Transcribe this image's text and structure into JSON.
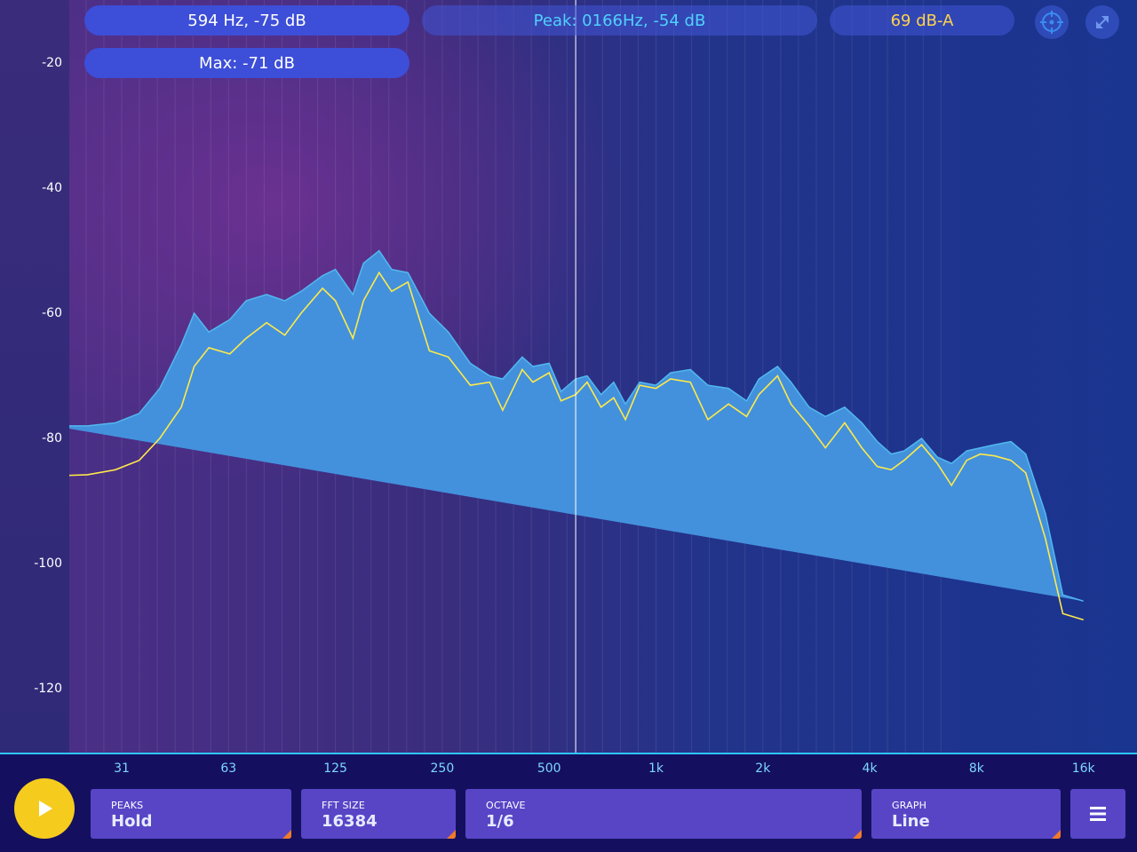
{
  "header": {
    "cursor_readout": "594 Hz, -75 dB",
    "max_readout": "Max: -71 dB",
    "peak_readout": "Peak: 0166Hz, -54 dB",
    "level_readout": "69 dB-A",
    "target_icon": "crosshair-icon",
    "fullscreen_icon": "fullscreen-icon"
  },
  "colors": {
    "peak_text": "#4fd1ff",
    "level_text": "#ffd34d",
    "spectrum_line": "#ffe94a",
    "peak_band": "#3fa9e8",
    "fill": "#5048b8",
    "play_button": "#f5cc1e",
    "corner_accent": "#f07a2a"
  },
  "chart_data": {
    "type": "area",
    "x_scale": "log",
    "xlim": [
      20,
      22000
    ],
    "ylim": [
      -130,
      -10
    ],
    "cursor_frequency": 594,
    "x_tick_labels": [
      "31",
      "63",
      "125",
      "250",
      "500",
      "1k",
      "2k",
      "4k",
      "8k",
      "16k"
    ],
    "y_tick_labels": [
      "-20",
      "-40",
      "-60",
      "-80",
      "-100",
      "-120"
    ],
    "x": [
      20,
      25,
      30,
      35,
      40,
      46,
      50,
      55,
      63,
      70,
      80,
      90,
      100,
      115,
      125,
      140,
      150,
      166,
      180,
      200,
      230,
      260,
      300,
      340,
      370,
      420,
      450,
      500,
      540,
      594,
      640,
      700,
      760,
      820,
      900,
      1000,
      1100,
      1250,
      1400,
      1600,
      1800,
      1950,
      2200,
      2400,
      2700,
      3000,
      3400,
      3800,
      4200,
      4600,
      5000,
      5600,
      6200,
      6800,
      7500,
      8200,
      9000,
      10000,
      11000,
      12500,
      14000,
      16000,
      17500,
      18500,
      19500,
      20500,
      21500,
      22000
    ],
    "series": [
      {
        "values": [
          -86,
          -85.8,
          -85,
          -83.5,
          -80,
          -75,
          -68.5,
          -65.5,
          -66.5,
          -64,
          -61.5,
          -63.5,
          -60,
          -56,
          -58,
          -64,
          -58,
          -53.5,
          -56.5,
          -55,
          -66,
          -67,
          -71.5,
          -71,
          -75.5,
          -69,
          -71,
          -69.5,
          -74,
          -73,
          -71,
          -75,
          -73.5,
          -77,
          -71.5,
          -72,
          -70.5,
          -71,
          -77,
          -74.5,
          -76.5,
          -73,
          -70,
          -74.5,
          -78,
          -81.5,
          -77.5,
          -81.5,
          -84.5,
          -85,
          -83.5,
          -81,
          -84,
          -87.5,
          -83.5,
          -82.5,
          -82.8,
          -83.5,
          -85.5,
          -96,
          -108,
          -109
        ]
      },
      {
        "name": "Max",
        "values": [
          -78,
          -78,
          -77.5,
          -76,
          -72,
          -65,
          -60,
          -63,
          -61,
          -58,
          -57,
          -58,
          -56.5,
          -54,
          -53,
          -57,
          -52,
          -50,
          -53,
          -53.5,
          -60,
          -63,
          -68,
          -70,
          -70.5,
          -67,
          -68.5,
          -68,
          -72.5,
          -70.5,
          -70,
          -73,
          -71,
          -74.5,
          -71,
          -71.5,
          -69.5,
          -69,
          -71.5,
          -72,
          -74,
          -70.5,
          -68.5,
          -71,
          -75,
          -76.5,
          -75,
          -77.5,
          -80.5,
          -82.5,
          -82,
          -80,
          -83,
          -84,
          -82,
          -81.5,
          -81,
          -80.5,
          -82.5,
          -92,
          -105,
          -106
        ]
      }
    ]
  },
  "controls": {
    "play_icon": "play-icon",
    "peaks": {
      "key": "PEAKS",
      "value": "Hold"
    },
    "fft_size": {
      "key": "FFT SIZE",
      "value": "16384"
    },
    "octave": {
      "key": "OCTAVE",
      "value": "1/6"
    },
    "graph": {
      "key": "GRAPH",
      "value": "Line"
    },
    "menu_icon": "menu-icon"
  }
}
